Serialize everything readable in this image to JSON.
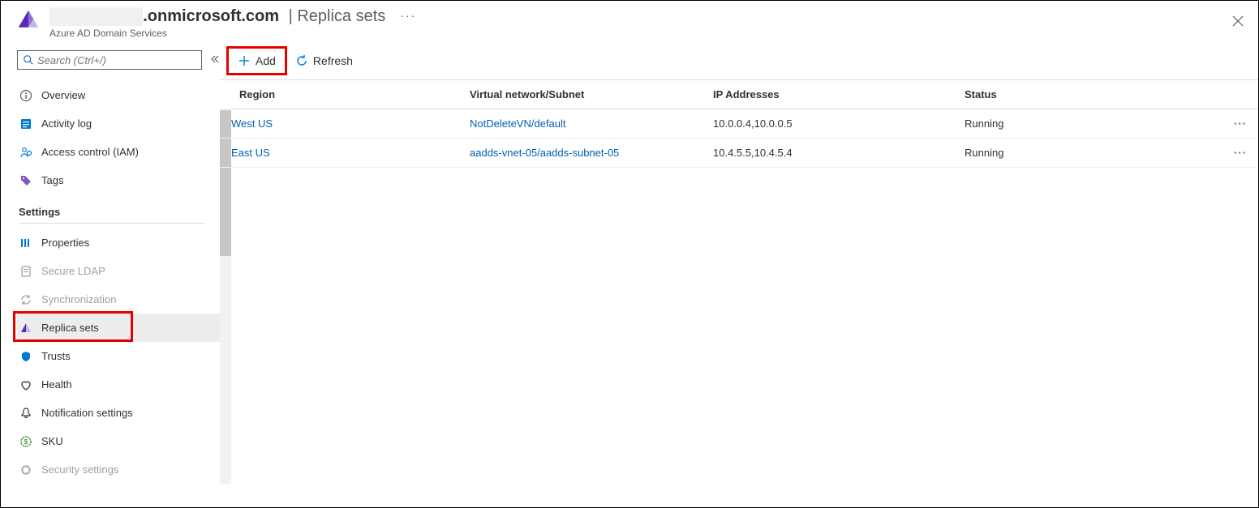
{
  "header": {
    "domain_prefix": "",
    "domain_suffix": ".onmicrosoft.com",
    "separator": "|",
    "page": "Replica sets",
    "more": "···",
    "subtitle": "Azure AD Domain Services"
  },
  "search": {
    "placeholder": "Search (Ctrl+/)"
  },
  "sidebar": {
    "items": [
      {
        "label": "Overview",
        "icon": "info"
      },
      {
        "label": "Activity log",
        "icon": "log"
      },
      {
        "label": "Access control (IAM)",
        "icon": "iam"
      },
      {
        "label": "Tags",
        "icon": "tag"
      }
    ],
    "settings_label": "Settings",
    "settings_items": [
      {
        "label": "Properties",
        "icon": "properties",
        "disabled": false
      },
      {
        "label": "Secure LDAP",
        "icon": "ldap",
        "disabled": true
      },
      {
        "label": "Synchronization",
        "icon": "sync",
        "disabled": true
      },
      {
        "label": "Replica sets",
        "icon": "replica",
        "disabled": false,
        "selected": true
      },
      {
        "label": "Trusts",
        "icon": "trusts",
        "disabled": false
      },
      {
        "label": "Health",
        "icon": "health",
        "disabled": false
      },
      {
        "label": "Notification settings",
        "icon": "bell",
        "disabled": false
      },
      {
        "label": "SKU",
        "icon": "sku",
        "disabled": false
      },
      {
        "label": "Security settings",
        "icon": "security",
        "disabled": true
      }
    ]
  },
  "toolbar": {
    "add_label": "Add",
    "refresh_label": "Refresh"
  },
  "table": {
    "headers": {
      "region": "Region",
      "vnet": "Virtual network/Subnet",
      "ip": "IP Addresses",
      "status": "Status"
    },
    "rows": [
      {
        "region": "West US",
        "vnet": "NotDeleteVN/default",
        "ip": "10.0.0.4,10.0.0.5",
        "status": "Running"
      },
      {
        "region": "East US",
        "vnet": "aadds-vnet-05/aadds-subnet-05",
        "ip": "10.4.5.5,10.4.5.4",
        "status": "Running"
      }
    ]
  }
}
